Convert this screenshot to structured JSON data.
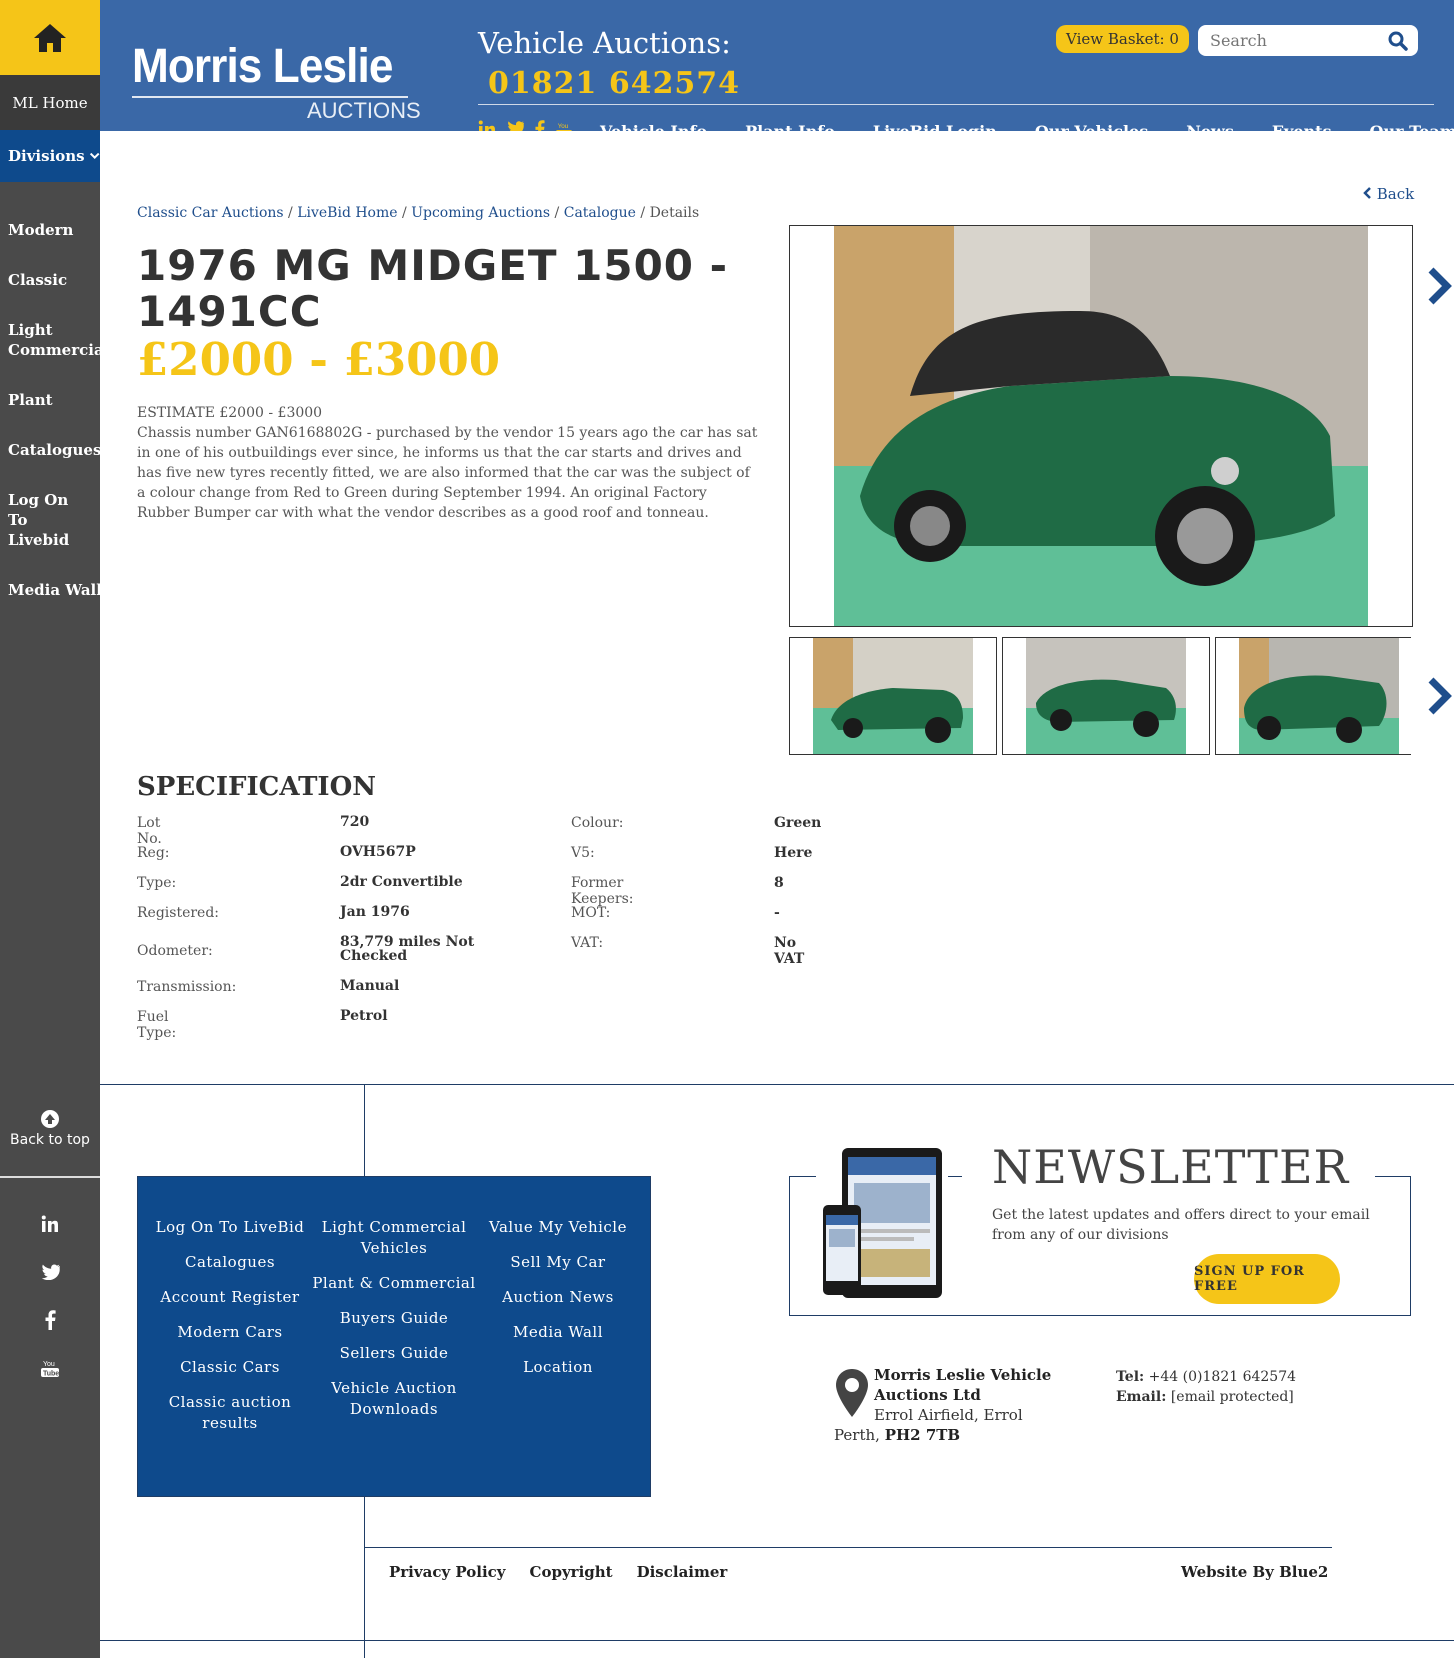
{
  "sidebar": {
    "home_icon": "home-icon",
    "ml_home": "ML Home",
    "divisions": "Divisions",
    "items": [
      "Modern",
      "Classic",
      "Light Commercial",
      "Plant",
      "Catalogues",
      "Log On To Livebid",
      "Media Wall"
    ],
    "back_to_top": "Back to top",
    "social_icons": [
      "linkedin-icon",
      "twitter-icon",
      "facebook-icon",
      "youtube-icon"
    ]
  },
  "header": {
    "logo_main": "Morris Leslie",
    "logo_sub": "AUCTIONS",
    "title": "Vehicle Auctions:",
    "phone": "01821 642574",
    "basket_label": "View Basket:",
    "basket_count": "0",
    "search_placeholder": "Search",
    "nav": [
      "Vehicle Info",
      "Plant Info",
      "LiveBid Login",
      "Our Vehicles",
      "News",
      "Events",
      "Our Team"
    ]
  },
  "breadcrumb": {
    "items": [
      "Classic Car Auctions",
      "LiveBid Home",
      "Upcoming Auctions",
      "Catalogue"
    ],
    "current": "Details"
  },
  "back_label": "Back",
  "listing": {
    "title": "1976 MG MIDGET 1500 - 1491CC",
    "price": "£2000 - £3000",
    "estimate": "ESTIMATE £2000 - £3000",
    "description": "Chassis number GAN6168802G - purchased by the vendor 15 years ago the car has sat in one of his outbuildings ever since, he informs us that the car starts and drives and has five new tyres recently fitted, we are also informed that the car was the subject of a colour change from Red to Green during September 1994. An original Factory Rubber Bumper car with what the vendor describes as a good roof and tonneau."
  },
  "specification": {
    "heading": "SPECIFICATION",
    "left": [
      {
        "label": "Lot No.",
        "value": "720"
      },
      {
        "label": "Reg:",
        "value": "OVH567P"
      },
      {
        "label": "Type:",
        "value": "2dr Convertible"
      },
      {
        "label": "Registered:",
        "value": "Jan 1976"
      },
      {
        "label": "Odometer:",
        "value": "83,779 miles Not Checked"
      },
      {
        "label": "Transmission:",
        "value": "Manual"
      },
      {
        "label": "Fuel Type:",
        "value": "Petrol"
      }
    ],
    "right": [
      {
        "label": "Colour:",
        "value": "Green"
      },
      {
        "label": "V5:",
        "value": "Here"
      },
      {
        "label": "Former Keepers:",
        "value": "8"
      },
      {
        "label": "MOT:",
        "value": "-"
      },
      {
        "label": "VAT:",
        "value": "No VAT"
      }
    ]
  },
  "footer": {
    "col1": [
      "Log On To LiveBid",
      "Catalogues",
      "Account Register",
      "Modern Cars",
      "Classic Cars",
      "Classic auction results"
    ],
    "col2": [
      "Light Commercial Vehicles",
      "Plant & Commercial",
      "Buyers Guide",
      "Sellers Guide",
      "Vehicle Auction Downloads"
    ],
    "col3": [
      "Value My Vehicle",
      "Sell My Car",
      "Auction News",
      "Media Wall",
      "Location"
    ],
    "newsletter_title": "NEWSLETTER",
    "newsletter_text": "Get the latest updates and offers direct to your email from any of our divisions",
    "newsletter_button": "SIGN UP FOR FREE",
    "company": "Morris Leslie Vehicle Auctions Ltd",
    "address_line": "Errol Airfield, Errol",
    "city": "Perth,",
    "postcode": "PH2 7TB",
    "tel_label": "Tel:",
    "tel": "+44 (0)1821 642574",
    "email_label": "Email:",
    "email": "[email protected]",
    "legal": [
      "Privacy Policy",
      "Copyright",
      "Disclaimer"
    ],
    "credit": "Website By Blue2"
  },
  "colors": {
    "header_blue": "#3a68a7",
    "accent_yellow": "#f5c518",
    "dark_blue": "#0e4a8c",
    "sidebar_grey": "#4a4a4a"
  }
}
